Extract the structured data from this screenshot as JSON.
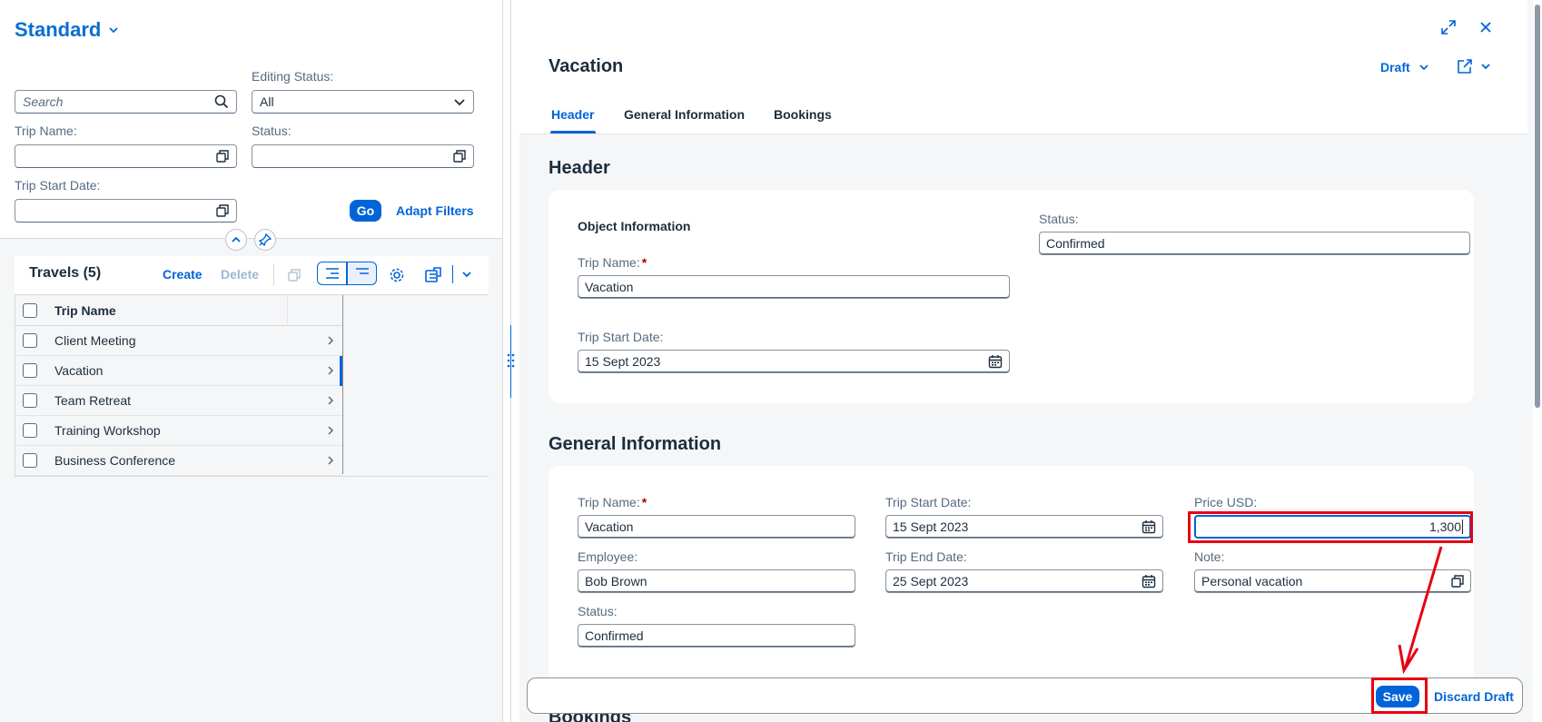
{
  "left": {
    "variant_title": "Standard",
    "search_placeholder": "Search",
    "filters": {
      "editing_status_label": "Editing Status:",
      "editing_status_value": "All",
      "trip_name_label": "Trip Name:",
      "status_label": "Status:",
      "trip_start_date_label": "Trip Start Date:",
      "go_label": "Go",
      "adapt_filters_label": "Adapt Filters"
    },
    "table": {
      "title": "Travels (5)",
      "create_label": "Create",
      "delete_label": "Delete",
      "column_header": "Trip Name",
      "rows": [
        {
          "name": "Client Meeting"
        },
        {
          "name": "Vacation"
        },
        {
          "name": "Team Retreat"
        },
        {
          "name": "Training Workshop"
        },
        {
          "name": "Business Conference"
        }
      ]
    }
  },
  "right": {
    "object_title": "Vacation",
    "draft_label": "Draft",
    "tabs": [
      {
        "label": "Header"
      },
      {
        "label": "General Information"
      },
      {
        "label": "Bookings"
      }
    ],
    "header_section": {
      "title": "Header",
      "object_information_label": "Object Information",
      "trip_name_label": "Trip Name:",
      "trip_name_value": "Vacation",
      "trip_start_date_label": "Trip Start Date:",
      "trip_start_date_value": "15 Sept 2023",
      "status_label": "Status:",
      "status_value": "Confirmed"
    },
    "general_section": {
      "title": "General Information",
      "trip_name_label": "Trip Name:",
      "trip_name_value": "Vacation",
      "employee_label": "Employee:",
      "employee_value": "Bob Brown",
      "status_label": "Status:",
      "status_value": "Confirmed",
      "trip_start_date_label": "Trip Start Date:",
      "trip_start_date_value": "15 Sept 2023",
      "trip_end_date_label": "Trip End Date:",
      "trip_end_date_value": "25 Sept 2023",
      "price_label": "Price USD:",
      "price_value": "1,300",
      "note_label": "Note:",
      "note_value": "Personal vacation"
    },
    "bookings_section_title": "Bookings",
    "footer": {
      "save_label": "Save",
      "discard_label": "Discard Draft"
    }
  },
  "colors": {
    "brand_blue": "#0064d9",
    "highlight_red": "#e60012"
  }
}
